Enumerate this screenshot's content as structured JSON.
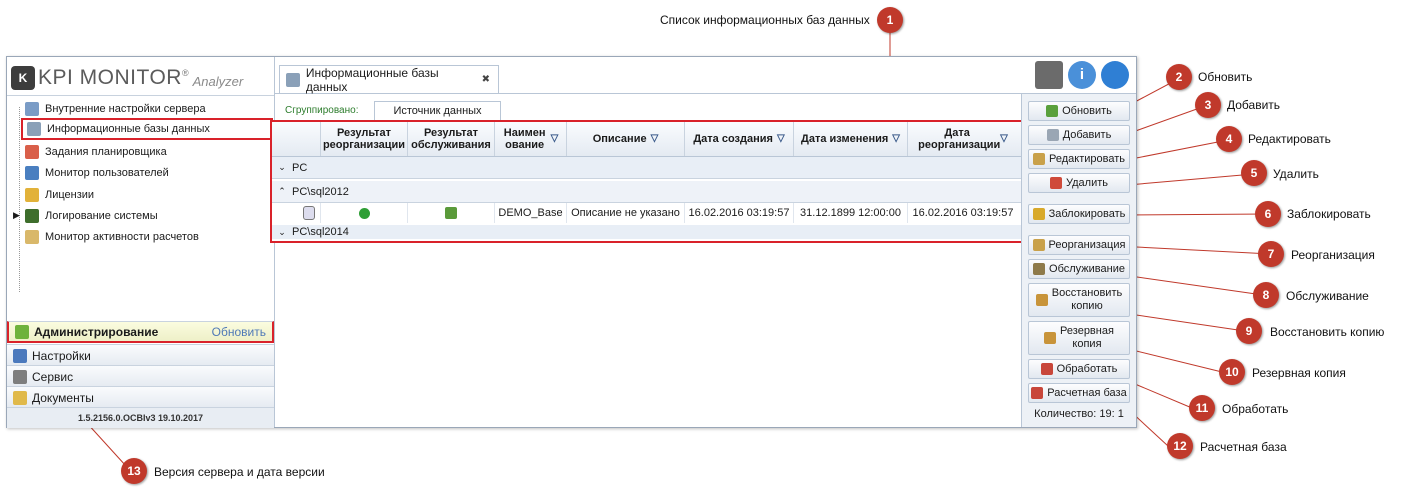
{
  "logo": {
    "mark": "K",
    "title": "KPI MONITOR",
    "registered": "®",
    "subtitle": "Analyzer"
  },
  "tree": [
    {
      "label": "Внутренние настройки сервера",
      "icon": "server-settings-icon"
    },
    {
      "label": "Информационные базы данных",
      "icon": "database-icon",
      "selected": true
    },
    {
      "label": "Задания планировщика",
      "icon": "calendar-icon"
    },
    {
      "label": "Монитор пользователей",
      "icon": "monitor-icon"
    },
    {
      "label": "Лицензии",
      "icon": "key-icon"
    },
    {
      "label": "Логирование системы",
      "icon": "log-icon",
      "expandable": true
    },
    {
      "label": "Монитор активности расчетов",
      "icon": "activity-icon"
    }
  ],
  "nav": {
    "admin": {
      "label": "Администрирование",
      "action": "Обновить"
    },
    "settings": "Настройки",
    "service": "Сервис",
    "documents": "Документы",
    "version": "1.5.2156.0.OCBIv3  19.10.2017"
  },
  "tab": {
    "label": "Информационные базы данных",
    "close": "✖"
  },
  "grouping": {
    "label": "Сгруппировано:",
    "chip": "Источник данных"
  },
  "grid": {
    "headers": [
      "Результат реорганизации",
      "Результат обслуживания",
      "Наимен ование",
      "Описание",
      "Дата создания",
      "Дата изменения",
      "Дата реорганизации"
    ],
    "groups": [
      "PC",
      "PC\\sql2012",
      "PC\\sql2014"
    ],
    "row": {
      "name": "DEMO_Base",
      "description": "Описание не указано",
      "created": "16.02.2016 03:19:57",
      "modified": "31.12.1899 12:00:00",
      "reorganized": "16.02.2016 03:19:57"
    }
  },
  "buttons": {
    "refresh": "Обновить",
    "add": "Добавить",
    "edit": "Редактировать",
    "delete": "Удалить",
    "lock": "Заблокировать",
    "reorg": "Реорганизация",
    "service": "Обслуживание",
    "restore1": "Восстановить",
    "restore2": "копию",
    "backup1": "Резервная",
    "backup2": "копия",
    "process": "Обработать",
    "calc": "Расчетная база"
  },
  "count": "Количество: 19: 1",
  "annotations": [
    {
      "n": "1",
      "text": "Список информационных баз данных"
    },
    {
      "n": "2",
      "text": "Обновить"
    },
    {
      "n": "3",
      "text": "Добавить"
    },
    {
      "n": "4",
      "text": "Редактировать"
    },
    {
      "n": "5",
      "text": "Удалить"
    },
    {
      "n": "6",
      "text": "Заблокировать"
    },
    {
      "n": "7",
      "text": "Реорганизация"
    },
    {
      "n": "8",
      "text": "Обслуживание"
    },
    {
      "n": "9",
      "text": "Восстановить копию"
    },
    {
      "n": "10",
      "text": "Резервная копия"
    },
    {
      "n": "11",
      "text": "Обработать"
    },
    {
      "n": "12",
      "text": "Расчетная база"
    },
    {
      "n": "13",
      "text": "Версия сервера и дата версии"
    }
  ],
  "colors": {
    "accent_red": "#c0392b",
    "highlight_red": "#d9222a",
    "ok_green": "#2e9e35"
  }
}
